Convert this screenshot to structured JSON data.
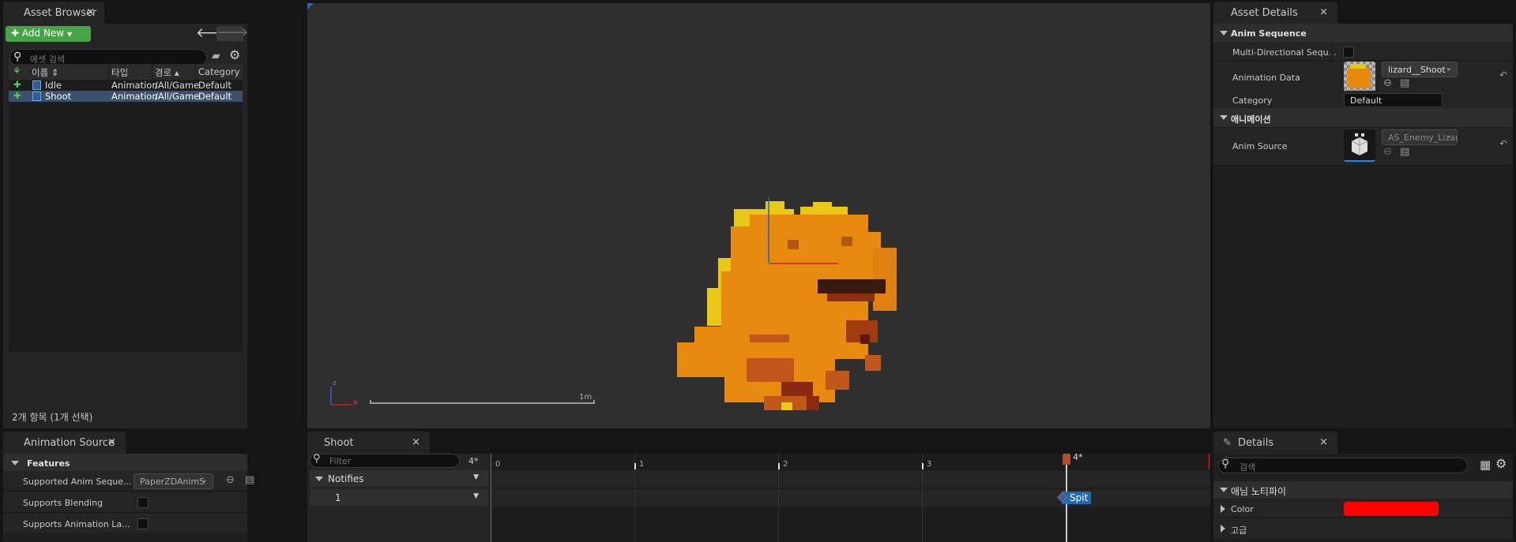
{
  "asset_browser": {
    "tab_title": "Asset Browser",
    "close": "×",
    "add_new": "Add New",
    "search_placeholder": "에셋 검색",
    "columns": {
      "name": "이름",
      "type": "타입",
      "path": "경로",
      "category": "Category"
    },
    "rows": [
      {
        "name": "Idle",
        "type": "Animation",
        "path": "/All/Game",
        "category": "Default",
        "selected": false
      },
      {
        "name": "Shoot",
        "type": "Animation",
        "path": "/All/Game",
        "category": "Default",
        "selected": true
      }
    ],
    "status": "2개 항목 (1개 선택)"
  },
  "viewport": {
    "axis_x": "x",
    "axis_z": "z",
    "scale_label": "1m"
  },
  "asset_details": {
    "tab_title": "Asset Details",
    "close": "×",
    "section_anim_sequence": "Anim Sequence",
    "multi_directional_label": "Multi-Directional Sequ...",
    "animation_data_label": "Animation Data",
    "animation_data_value": "lizard__Shoot",
    "category_label": "Category",
    "category_value": "Default",
    "section_animation": "애니메이션",
    "anim_source_label": "Anim Source",
    "anim_source_value": "AS_Enemy_Lizard"
  },
  "animation_source": {
    "tab_title": "Animation Source",
    "close": "×",
    "section_features": "Features",
    "supported_anim_label": "Supported Anim Seque...",
    "supported_anim_value": "PaperZDAnimS",
    "supports_blending_label": "Supports Blending",
    "supports_layers_label": "Supports Animation La..."
  },
  "timeline": {
    "tab_title": "Shoot",
    "close": "×",
    "filter_placeholder": "Filter",
    "frame_badge": "4*",
    "notifies_label": "Notifies",
    "track_label": "1",
    "ticks": [
      "0",
      "1",
      "2",
      "3"
    ],
    "playhead_label": "4*",
    "notify_name": "Spit"
  },
  "details": {
    "tab_title": "Details",
    "close": "×",
    "search_placeholder": "검색",
    "section_anim_notify": "애님 노티파이",
    "color_label": "Color",
    "color_value": "#ff0000",
    "advanced_label": "고급"
  },
  "colors": {
    "accent_blue": "#1b6db3",
    "selection": "#3b4f6e",
    "add_green": "#47a447"
  }
}
